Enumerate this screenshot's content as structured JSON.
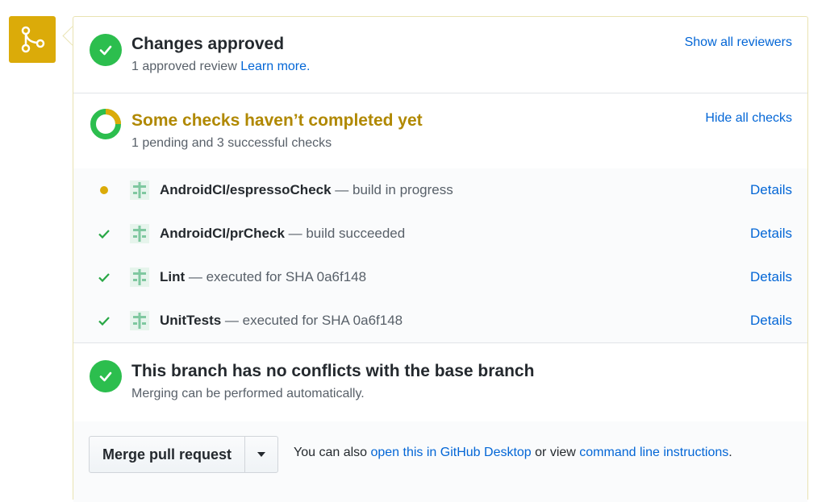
{
  "approval": {
    "title": "Changes approved",
    "subtitle": "1 approved review",
    "learn_more": "Learn more.",
    "show_reviewers": "Show all reviewers"
  },
  "checks": {
    "title": "Some checks haven’t completed yet",
    "subtitle": "1 pending and 3 successful checks",
    "hide_checks": "Hide all checks",
    "progress": {
      "pending": 1,
      "successful": 3
    },
    "items": [
      {
        "status": "pending",
        "name": "AndroidCI/espressoCheck",
        "description": " — build in progress",
        "details": "Details"
      },
      {
        "status": "success",
        "name": "AndroidCI/prCheck",
        "description": " — build succeeded",
        "details": "Details"
      },
      {
        "status": "success",
        "name": "Lint",
        "description": " — executed for SHA 0a6f148",
        "details": "Details"
      },
      {
        "status": "success",
        "name": "UnitTests",
        "description": " — executed for SHA 0a6f148",
        "details": "Details"
      }
    ]
  },
  "conflicts": {
    "title": "This branch has no conflicts with the base branch",
    "subtitle": "Merging can be performed automatically."
  },
  "merge": {
    "button_label": "Merge pull request",
    "hint_prefix": "You can also ",
    "desktop_link": "open this in GitHub Desktop",
    "hint_middle": " or view ",
    "cli_link": "command line instructions",
    "hint_suffix": "."
  },
  "colors": {
    "success": "#2cbe4e",
    "pending": "#dbab09",
    "link": "#0366d6",
    "pending_title": "#b08800"
  },
  "icons": {
    "merge_badge": "git-merge-icon",
    "approved": "check-circle-icon",
    "checks": "progress-ring-icon",
    "ci": "ci-logo-icon"
  }
}
